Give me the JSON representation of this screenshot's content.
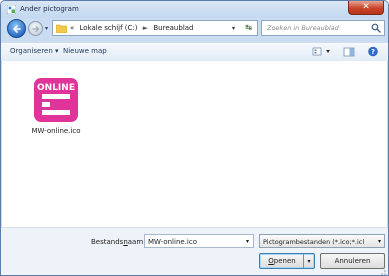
{
  "window": {
    "title": "Ander pictogram",
    "close_icon": "close-icon",
    "accent": "#c8452b"
  },
  "nav": {
    "crumb_root": "«",
    "crumb_drive": "Lokale schijf (C:)",
    "crumb_sep": "►",
    "crumb_folder": "Bureaublad",
    "search_placeholder": "Zoeken in Bureaublad"
  },
  "toolbar": {
    "organise_label": "Organiseren ▾",
    "new_folder_label": "Nieuwe map"
  },
  "files": [
    {
      "name": "MW-online.ico",
      "icon_text": "ONLINE",
      "icon_color": "#e0349a"
    }
  ],
  "footer": {
    "filename_label": "Bestandsnaam:",
    "filename_value": "MW-online.ico",
    "filter_value": "Pictogrambestanden (*.ico;*.icl",
    "open_label": "Openen",
    "cancel_label": "Annuleren"
  }
}
